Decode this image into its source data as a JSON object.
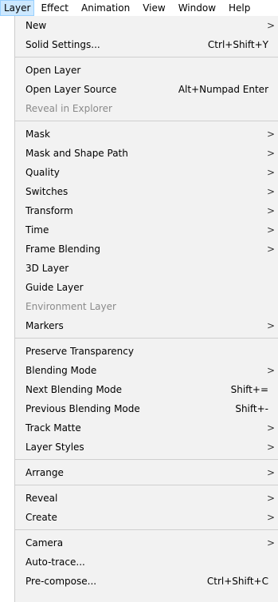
{
  "menubar": {
    "items": [
      "Layer",
      "Effect",
      "Animation",
      "View",
      "Window",
      "Help"
    ]
  },
  "menu": {
    "groups": [
      [
        {
          "label": "New",
          "submenu": true
        },
        {
          "label": "Solid Settings...",
          "shortcut": "Ctrl+Shift+Y"
        }
      ],
      [
        {
          "label": "Open Layer"
        },
        {
          "label": "Open Layer Source",
          "shortcut": "Alt+Numpad Enter"
        },
        {
          "label": "Reveal in Explorer",
          "disabled": true
        }
      ],
      [
        {
          "label": "Mask",
          "submenu": true
        },
        {
          "label": "Mask and Shape Path",
          "submenu": true
        },
        {
          "label": "Quality",
          "submenu": true
        },
        {
          "label": "Switches",
          "submenu": true
        },
        {
          "label": "Transform",
          "submenu": true
        },
        {
          "label": "Time",
          "submenu": true
        },
        {
          "label": "Frame Blending",
          "submenu": true
        },
        {
          "label": "3D Layer"
        },
        {
          "label": "Guide Layer"
        },
        {
          "label": "Environment Layer",
          "disabled": true
        },
        {
          "label": "Markers",
          "submenu": true
        }
      ],
      [
        {
          "label": "Preserve Transparency"
        },
        {
          "label": "Blending Mode",
          "submenu": true
        },
        {
          "label": "Next Blending Mode",
          "shortcut": "Shift+="
        },
        {
          "label": "Previous Blending Mode",
          "shortcut": "Shift+-"
        },
        {
          "label": "Track Matte",
          "submenu": true
        },
        {
          "label": "Layer Styles",
          "submenu": true
        }
      ],
      [
        {
          "label": "Arrange",
          "submenu": true
        }
      ],
      [
        {
          "label": "Reveal",
          "submenu": true
        },
        {
          "label": "Create",
          "submenu": true
        }
      ],
      [
        {
          "label": "Camera",
          "submenu": true
        },
        {
          "label": "Auto-trace..."
        },
        {
          "label": "Pre-compose...",
          "shortcut": "Ctrl+Shift+C"
        }
      ]
    ],
    "submenu_arrow": ">"
  }
}
